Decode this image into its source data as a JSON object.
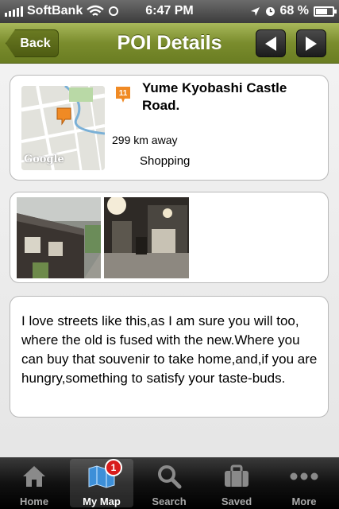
{
  "status_bar": {
    "carrier": "SoftBank",
    "time": "6:47 PM",
    "battery": "68 %",
    "battery_level": 0.68
  },
  "navbar": {
    "back_label": "Back",
    "title": "POI Details"
  },
  "poi": {
    "badge_number": "11",
    "name": "Yume Kyobashi Castle Road.",
    "distance": "299 km away",
    "category": "Shopping",
    "map_provider": "Google"
  },
  "description": "I love streets like this,as I am sure you will too, where the old is fused with the new.Where you can buy that souvenir to take home,and,if you are hungry,something to satisfy your taste-buds.",
  "tabs": [
    {
      "label": "Home",
      "icon": "home-icon"
    },
    {
      "label": "My Map",
      "icon": "map-icon",
      "badge": "1",
      "active": true
    },
    {
      "label": "Search",
      "icon": "search-icon"
    },
    {
      "label": "Saved",
      "icon": "briefcase-icon"
    },
    {
      "label": "More",
      "icon": "more-icon"
    }
  ],
  "colors": {
    "navbar": "#7a8c2d",
    "badge": "#d81c1c",
    "poi_marker": "#f08a24"
  }
}
